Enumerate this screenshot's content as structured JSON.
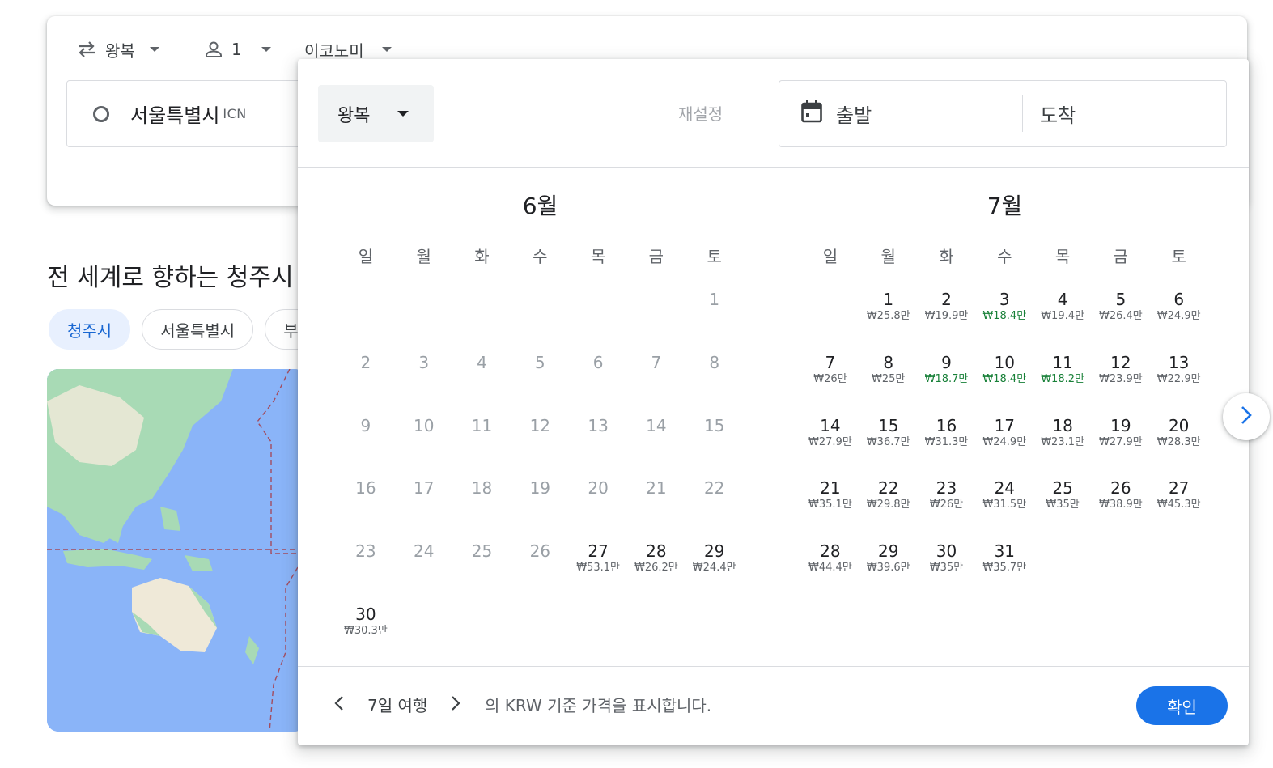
{
  "search": {
    "trip_type": "왕복",
    "passengers": "1",
    "cabin_class": "이코노미",
    "origin_city": "서울특별시",
    "origin_code": "ICN"
  },
  "explore": {
    "title": "전 세계로 향하는 청주시",
    "chips": [
      "청주시",
      "서울특별시",
      "부"
    ]
  },
  "picker": {
    "trip_type": "왕복",
    "reset_label": "재설정",
    "departure_placeholder": "출발",
    "return_placeholder": "도착",
    "weekdays": [
      "일",
      "월",
      "화",
      "수",
      "목",
      "금",
      "토"
    ],
    "months": [
      {
        "title": "6월",
        "leading_blanks": 6,
        "days": [
          {
            "d": "1",
            "p": "",
            "past": true
          },
          {
            "d": "2",
            "p": "",
            "past": true
          },
          {
            "d": "3",
            "p": "",
            "past": true
          },
          {
            "d": "4",
            "p": "",
            "past": true
          },
          {
            "d": "5",
            "p": "",
            "past": true
          },
          {
            "d": "6",
            "p": "",
            "past": true
          },
          {
            "d": "7",
            "p": "",
            "past": true
          },
          {
            "d": "8",
            "p": "",
            "past": true
          },
          {
            "d": "9",
            "p": "",
            "past": true
          },
          {
            "d": "10",
            "p": "",
            "past": true
          },
          {
            "d": "11",
            "p": "",
            "past": true
          },
          {
            "d": "12",
            "p": "",
            "past": true
          },
          {
            "d": "13",
            "p": "",
            "past": true
          },
          {
            "d": "14",
            "p": "",
            "past": true
          },
          {
            "d": "15",
            "p": "",
            "past": true
          },
          {
            "d": "16",
            "p": "",
            "past": true
          },
          {
            "d": "17",
            "p": "",
            "past": true
          },
          {
            "d": "18",
            "p": "",
            "past": true
          },
          {
            "d": "19",
            "p": "",
            "past": true
          },
          {
            "d": "20",
            "p": "",
            "past": true
          },
          {
            "d": "21",
            "p": "",
            "past": true
          },
          {
            "d": "22",
            "p": "",
            "past": true
          },
          {
            "d": "23",
            "p": "",
            "past": true
          },
          {
            "d": "24",
            "p": "",
            "past": true
          },
          {
            "d": "25",
            "p": "",
            "past": true
          },
          {
            "d": "26",
            "p": "",
            "past": true
          },
          {
            "d": "27",
            "p": "₩53.1만"
          },
          {
            "d": "28",
            "p": "₩26.2만"
          },
          {
            "d": "29",
            "p": "₩24.4만"
          },
          {
            "d": "30",
            "p": "₩30.3만"
          }
        ]
      },
      {
        "title": "7월",
        "leading_blanks": 1,
        "days": [
          {
            "d": "1",
            "p": "₩25.8만"
          },
          {
            "d": "2",
            "p": "₩19.9만"
          },
          {
            "d": "3",
            "p": "₩18.4만",
            "low": true
          },
          {
            "d": "4",
            "p": "₩19.4만"
          },
          {
            "d": "5",
            "p": "₩26.4만"
          },
          {
            "d": "6",
            "p": "₩24.9만"
          },
          {
            "d": "7",
            "p": "₩26만"
          },
          {
            "d": "8",
            "p": "₩25만"
          },
          {
            "d": "9",
            "p": "₩18.7만",
            "low": true
          },
          {
            "d": "10",
            "p": "₩18.4만",
            "low": true
          },
          {
            "d": "11",
            "p": "₩18.2만",
            "low": true
          },
          {
            "d": "12",
            "p": "₩23.9만"
          },
          {
            "d": "13",
            "p": "₩22.9만"
          },
          {
            "d": "14",
            "p": "₩27.9만"
          },
          {
            "d": "15",
            "p": "₩36.7만"
          },
          {
            "d": "16",
            "p": "₩31.3만"
          },
          {
            "d": "17",
            "p": "₩24.9만"
          },
          {
            "d": "18",
            "p": "₩23.1만"
          },
          {
            "d": "19",
            "p": "₩27.9만"
          },
          {
            "d": "20",
            "p": "₩28.3만"
          },
          {
            "d": "21",
            "p": "₩35.1만"
          },
          {
            "d": "22",
            "p": "₩29.8만"
          },
          {
            "d": "23",
            "p": "₩26만"
          },
          {
            "d": "24",
            "p": "₩31.5만"
          },
          {
            "d": "25",
            "p": "₩35만"
          },
          {
            "d": "26",
            "p": "₩38.9만"
          },
          {
            "d": "27",
            "p": "₩45.3만"
          },
          {
            "d": "28",
            "p": "₩44.4만"
          },
          {
            "d": "29",
            "p": "₩39.6만"
          },
          {
            "d": "30",
            "p": "₩35만"
          },
          {
            "d": "31",
            "p": "₩35.7만"
          }
        ]
      }
    ],
    "footer": {
      "duration": "7일 여행",
      "note": "의 KRW 기준 가격을 표시합니다.",
      "confirm_label": "확인"
    }
  },
  "colors": {
    "accent": "#1a73e8",
    "low_price": "#188038",
    "map_ocean": "#8ab4f8",
    "map_land": "#a8dab5"
  }
}
